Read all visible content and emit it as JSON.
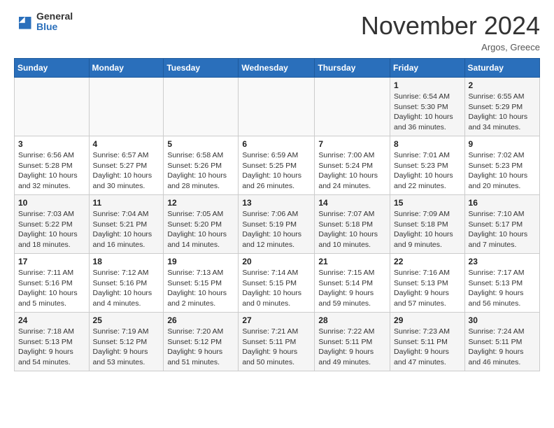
{
  "header": {
    "logo_line1": "General",
    "logo_line2": "Blue",
    "month": "November 2024",
    "location": "Argos, Greece"
  },
  "weekdays": [
    "Sunday",
    "Monday",
    "Tuesday",
    "Wednesday",
    "Thursday",
    "Friday",
    "Saturday"
  ],
  "weeks": [
    [
      {
        "day": "",
        "info": ""
      },
      {
        "day": "",
        "info": ""
      },
      {
        "day": "",
        "info": ""
      },
      {
        "day": "",
        "info": ""
      },
      {
        "day": "",
        "info": ""
      },
      {
        "day": "1",
        "info": "Sunrise: 6:54 AM\nSunset: 5:30 PM\nDaylight: 10 hours\nand 36 minutes."
      },
      {
        "day": "2",
        "info": "Sunrise: 6:55 AM\nSunset: 5:29 PM\nDaylight: 10 hours\nand 34 minutes."
      }
    ],
    [
      {
        "day": "3",
        "info": "Sunrise: 6:56 AM\nSunset: 5:28 PM\nDaylight: 10 hours\nand 32 minutes."
      },
      {
        "day": "4",
        "info": "Sunrise: 6:57 AM\nSunset: 5:27 PM\nDaylight: 10 hours\nand 30 minutes."
      },
      {
        "day": "5",
        "info": "Sunrise: 6:58 AM\nSunset: 5:26 PM\nDaylight: 10 hours\nand 28 minutes."
      },
      {
        "day": "6",
        "info": "Sunrise: 6:59 AM\nSunset: 5:25 PM\nDaylight: 10 hours\nand 26 minutes."
      },
      {
        "day": "7",
        "info": "Sunrise: 7:00 AM\nSunset: 5:24 PM\nDaylight: 10 hours\nand 24 minutes."
      },
      {
        "day": "8",
        "info": "Sunrise: 7:01 AM\nSunset: 5:23 PM\nDaylight: 10 hours\nand 22 minutes."
      },
      {
        "day": "9",
        "info": "Sunrise: 7:02 AM\nSunset: 5:23 PM\nDaylight: 10 hours\nand 20 minutes."
      }
    ],
    [
      {
        "day": "10",
        "info": "Sunrise: 7:03 AM\nSunset: 5:22 PM\nDaylight: 10 hours\nand 18 minutes."
      },
      {
        "day": "11",
        "info": "Sunrise: 7:04 AM\nSunset: 5:21 PM\nDaylight: 10 hours\nand 16 minutes."
      },
      {
        "day": "12",
        "info": "Sunrise: 7:05 AM\nSunset: 5:20 PM\nDaylight: 10 hours\nand 14 minutes."
      },
      {
        "day": "13",
        "info": "Sunrise: 7:06 AM\nSunset: 5:19 PM\nDaylight: 10 hours\nand 12 minutes."
      },
      {
        "day": "14",
        "info": "Sunrise: 7:07 AM\nSunset: 5:18 PM\nDaylight: 10 hours\nand 10 minutes."
      },
      {
        "day": "15",
        "info": "Sunrise: 7:09 AM\nSunset: 5:18 PM\nDaylight: 10 hours\nand 9 minutes."
      },
      {
        "day": "16",
        "info": "Sunrise: 7:10 AM\nSunset: 5:17 PM\nDaylight: 10 hours\nand 7 minutes."
      }
    ],
    [
      {
        "day": "17",
        "info": "Sunrise: 7:11 AM\nSunset: 5:16 PM\nDaylight: 10 hours\nand 5 minutes."
      },
      {
        "day": "18",
        "info": "Sunrise: 7:12 AM\nSunset: 5:16 PM\nDaylight: 10 hours\nand 4 minutes."
      },
      {
        "day": "19",
        "info": "Sunrise: 7:13 AM\nSunset: 5:15 PM\nDaylight: 10 hours\nand 2 minutes."
      },
      {
        "day": "20",
        "info": "Sunrise: 7:14 AM\nSunset: 5:15 PM\nDaylight: 10 hours\nand 0 minutes."
      },
      {
        "day": "21",
        "info": "Sunrise: 7:15 AM\nSunset: 5:14 PM\nDaylight: 9 hours\nand 59 minutes."
      },
      {
        "day": "22",
        "info": "Sunrise: 7:16 AM\nSunset: 5:13 PM\nDaylight: 9 hours\nand 57 minutes."
      },
      {
        "day": "23",
        "info": "Sunrise: 7:17 AM\nSunset: 5:13 PM\nDaylight: 9 hours\nand 56 minutes."
      }
    ],
    [
      {
        "day": "24",
        "info": "Sunrise: 7:18 AM\nSunset: 5:13 PM\nDaylight: 9 hours\nand 54 minutes."
      },
      {
        "day": "25",
        "info": "Sunrise: 7:19 AM\nSunset: 5:12 PM\nDaylight: 9 hours\nand 53 minutes."
      },
      {
        "day": "26",
        "info": "Sunrise: 7:20 AM\nSunset: 5:12 PM\nDaylight: 9 hours\nand 51 minutes."
      },
      {
        "day": "27",
        "info": "Sunrise: 7:21 AM\nSunset: 5:11 PM\nDaylight: 9 hours\nand 50 minutes."
      },
      {
        "day": "28",
        "info": "Sunrise: 7:22 AM\nSunset: 5:11 PM\nDaylight: 9 hours\nand 49 minutes."
      },
      {
        "day": "29",
        "info": "Sunrise: 7:23 AM\nSunset: 5:11 PM\nDaylight: 9 hours\nand 47 minutes."
      },
      {
        "day": "30",
        "info": "Sunrise: 7:24 AM\nSunset: 5:11 PM\nDaylight: 9 hours\nand 46 minutes."
      }
    ]
  ]
}
